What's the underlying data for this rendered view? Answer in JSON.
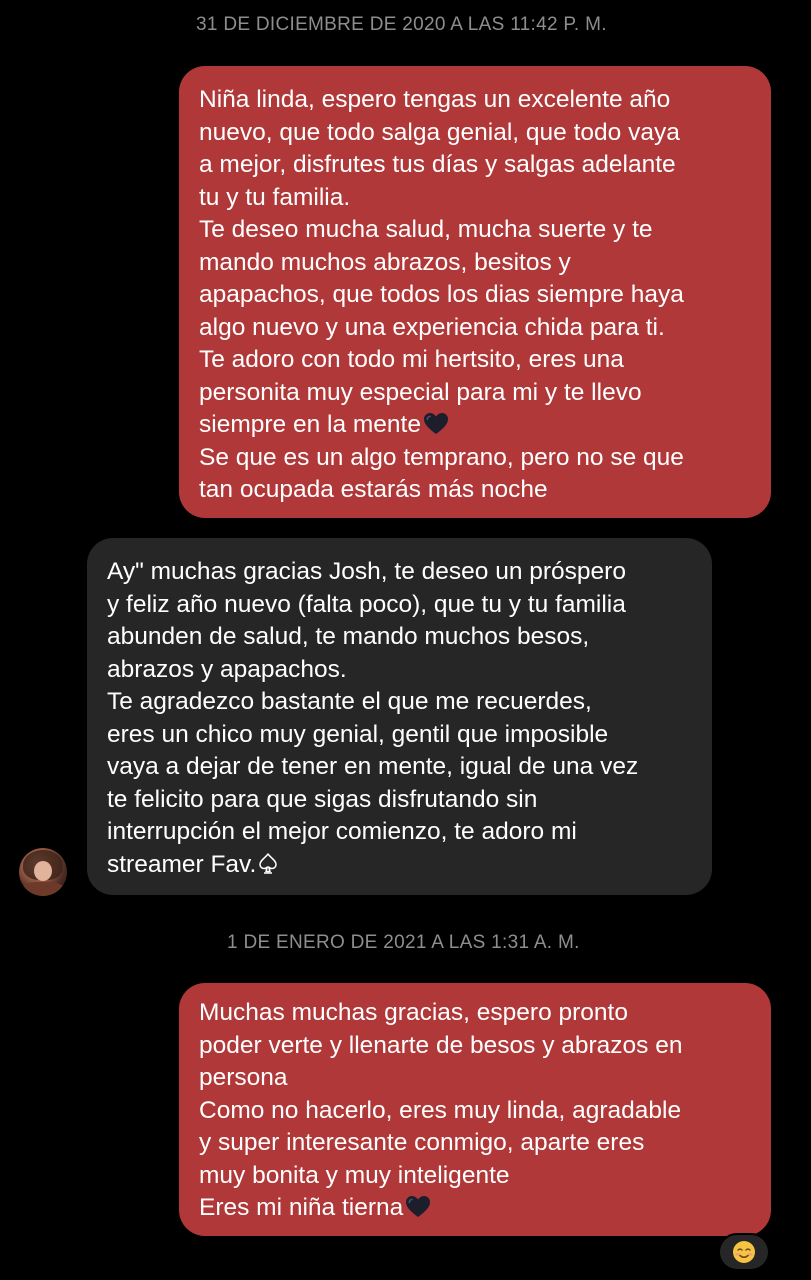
{
  "timestamps": [
    "31 DE DICIEMBRE DE 2020 A LAS 11:42 P. M.",
    "1 DE ENERO DE 2021 A LAS 1:31 A. M."
  ],
  "messages": [
    {
      "direction": "sent",
      "text": "Niña linda, espero tengas un excelente año\nnuevo, que todo salga genial, que todo vaya\na mejor, disfrutes tus días y salgas adelante\ntu y tu familia.\nTe deseo mucha salud, mucha suerte y te\nmando muchos abrazos, besitos y\napapachos, que todos los dias siempre haya\nalgo nuevo y una experiencia chida para ti.\nTe adoro con todo mi hertsito, eres una\npersonita muy especial para mi y te llevo\nsiempre en la mente",
      "text_after_emoji": "\nSe que es un algo temprano, pero no se que\ntan ocupada estarás más noche",
      "emoji": "black-heart-icon"
    },
    {
      "direction": "received",
      "text": "Ay\" muchas gracias Josh, te deseo un próspero\ny feliz año nuevo (falta poco), que tu y tu familia\nabunden de salud, te mando muchos besos,\nabrazos y apapachos.\nTe agradezco bastante el que me recuerdes,\neres un chico muy genial, gentil que imposible\nvaya a dejar de tener en mente, igual de una vez\nte felicito para que sigas disfrutando sin\ninterrupción el mejor comienzo, te adoro mi\nstreamer Fav.",
      "emoji": "spade-outline-icon"
    },
    {
      "direction": "sent",
      "text": "Muchas muchas gracias, espero pronto\npoder verte y llenarte de besos y abrazos en\npersona\nComo no hacerlo, eres muy linda, agradable\ny super interesante conmigo, aparte eres\nmuy bonita y muy inteligente\nEres mi niña tierna",
      "emoji": "black-heart-icon",
      "reaction": "smiling-face-icon"
    }
  ],
  "colors": {
    "background": "#000000",
    "sent_bubble": "#b03839",
    "received_bubble": "#262626",
    "timestamp_text": "#8e8e8e"
  }
}
